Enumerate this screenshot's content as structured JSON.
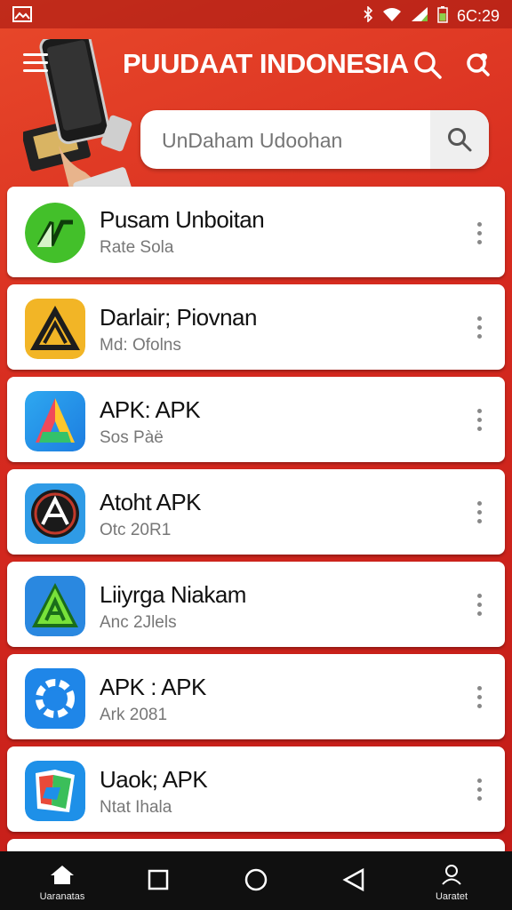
{
  "status_bar": {
    "time": "6C:29",
    "icons": [
      "gallery-icon",
      "bluetooth-icon",
      "wifi-icon",
      "signal-icon",
      "battery-icon"
    ]
  },
  "header": {
    "title": "PUUDAAT INDONESIA",
    "search_placeholder": "UnDaham Udoohan"
  },
  "apps": [
    {
      "name": "Pusam Unboitan",
      "sub": "Rate Sola",
      "icon": "green-app-icon"
    },
    {
      "name": "Darlair; Piovnan",
      "sub": "Md: Ofolns",
      "icon": "warning-app-icon"
    },
    {
      "name": "APK: APK",
      "sub": "Sos Pàë",
      "icon": "a-gradient-app-icon"
    },
    {
      "name": "Atoht APK",
      "sub": "Otc 20R1",
      "icon": "circle-badge-app-icon"
    },
    {
      "name": "Liiyrga Niakam",
      "sub": "Anc 2Jlels",
      "icon": "green-triangle-app-icon"
    },
    {
      "name": "APK : APK",
      "sub": "Ark 2081",
      "icon": "blue-gear-app-icon"
    },
    {
      "name": "Uaok; APK",
      "sub": "Ntat Ihala",
      "icon": "map-app-icon"
    }
  ],
  "nav": {
    "home_label": "Uaranatas",
    "profile_label": "Uaratet"
  },
  "colors": {
    "header_red": "#d62a1f",
    "card_bg": "#ffffff",
    "navbar_bg": "#101010"
  }
}
